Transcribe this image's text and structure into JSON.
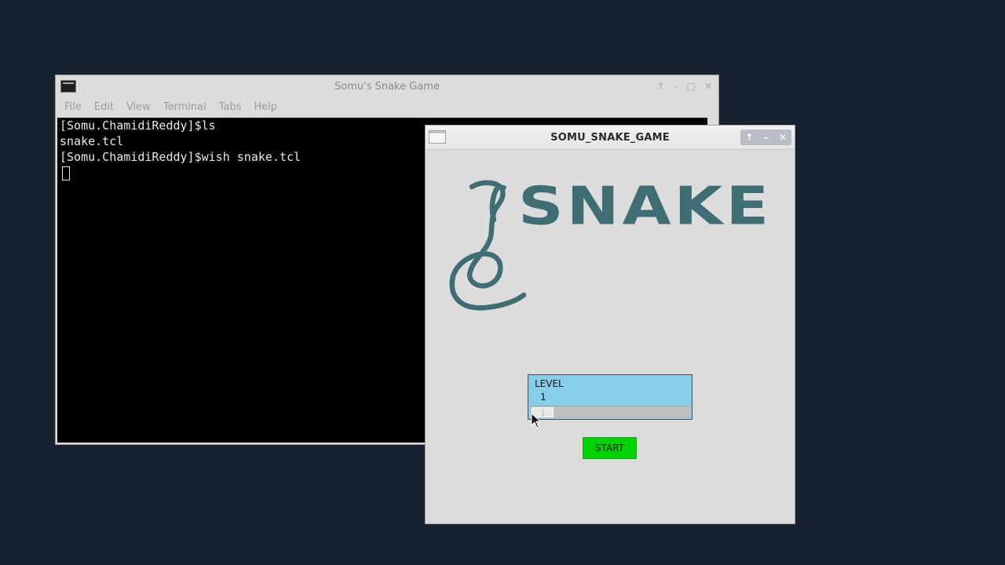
{
  "terminal": {
    "title": "Somu's Snake Game",
    "menu": [
      "File",
      "Edit",
      "View",
      "Terminal",
      "Tabs",
      "Help"
    ],
    "lines": [
      "[Somu.ChamidiReddy]$ls",
      "snake.tcl",
      "[Somu.ChamidiReddy]$wish snake.tcl"
    ],
    "icons": {
      "app": "terminal-icon",
      "controls": [
        "up-arrow-icon",
        "minimize-icon",
        "maximize-icon",
        "close-icon"
      ]
    }
  },
  "game": {
    "title": "SOMU_SNAKE_GAME",
    "logo_text": "SNAKE",
    "logo_color": "#3e6e73",
    "level": {
      "label": "LEVEL",
      "value": "1",
      "bg_color": "#87ceeb"
    },
    "start_label": "START",
    "start_color": "#00d400",
    "icons": {
      "app": "window-icon",
      "controls": [
        "up-arrow-icon",
        "minimize-icon",
        "close-icon"
      ]
    }
  },
  "desktop": {
    "background": "#172230"
  }
}
